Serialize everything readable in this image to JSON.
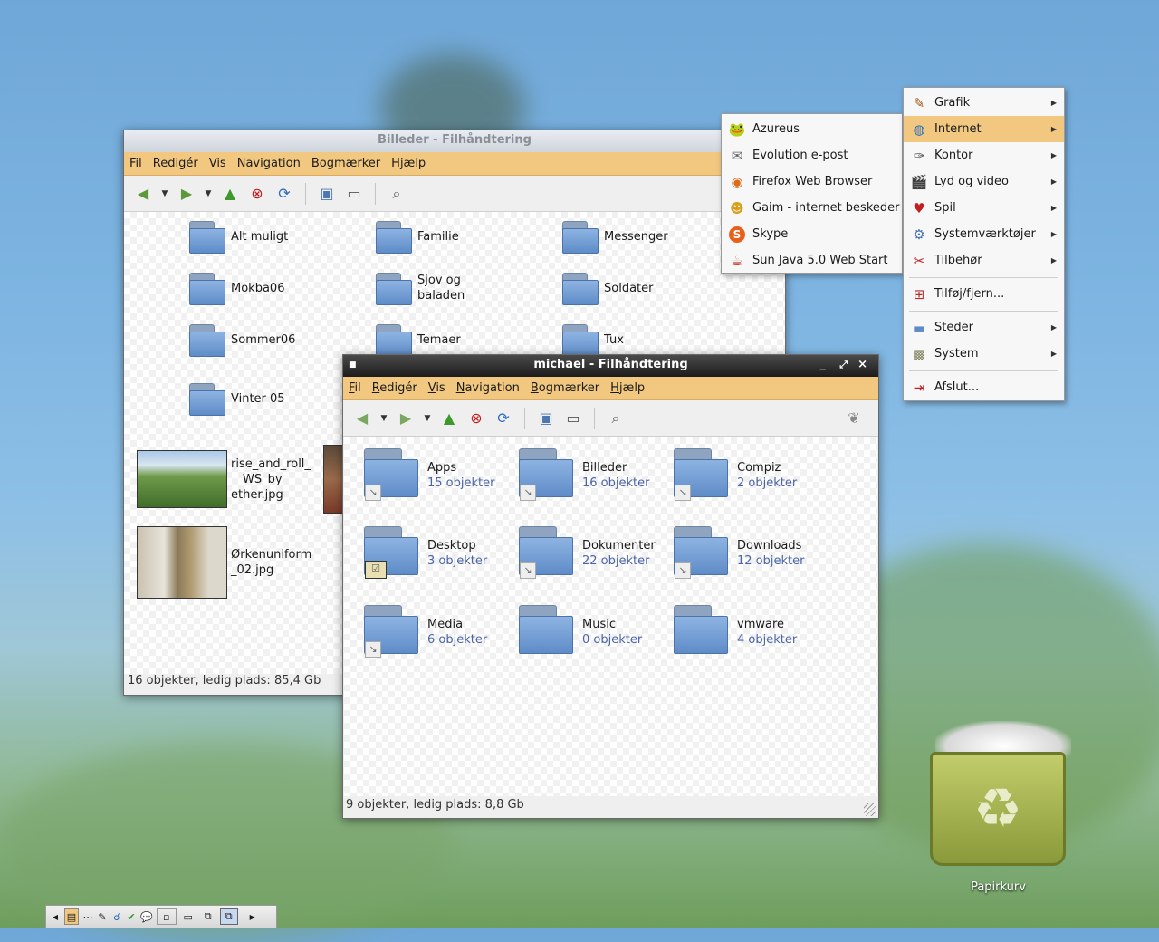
{
  "colors": {
    "menubar": "#f2c880",
    "highlight": "#f2c880",
    "count_text": "#4b63a8",
    "front_titlebar": "#1c1c1c"
  },
  "back_window": {
    "title": "Billeder - Filhåndtering",
    "menu": [
      "Fil",
      "Redigér",
      "Vis",
      "Navigation",
      "Bogmærker",
      "Hjælp"
    ],
    "toolbar_icons": [
      "back-arrow-icon",
      "dropdown-icon",
      "forward-arrow-icon",
      "dropdown-icon",
      "up-arrow-icon",
      "stop-icon",
      "reload-icon",
      "home-folder-icon",
      "computer-icon",
      "search-icon"
    ],
    "items": [
      {
        "name": "Alt muligt"
      },
      {
        "name": "Familie"
      },
      {
        "name": "Messenger"
      },
      {
        "name": "Mokba06"
      },
      {
        "name": "Sjov og\nbaladen"
      },
      {
        "name": "Soldater"
      },
      {
        "name": "Sommer06"
      },
      {
        "name": "Temaer"
      },
      {
        "name": "Tux"
      },
      {
        "name": "Vinter 05"
      },
      {
        "name": "rise_and_roll_\n__WS_by_\nether.jpg"
      },
      {
        "name": "Ørkenuniform\n_02.jpg"
      }
    ],
    "status": "16 objekter, ledig plads: 85,4 Gb"
  },
  "front_window": {
    "title": "michael - Filhåndtering",
    "menu": [
      "Fil",
      "Redigér",
      "Vis",
      "Navigation",
      "Bogmærker",
      "Hjælp"
    ],
    "title_controls": [
      "_",
      "⤢",
      "×"
    ],
    "items": [
      {
        "name": "Apps",
        "count": "15 objekter"
      },
      {
        "name": "Billeder",
        "count": "16 objekter"
      },
      {
        "name": "Compiz",
        "count": "2 objekter"
      },
      {
        "name": "Desktop",
        "count": "3 objekter"
      },
      {
        "name": "Dokumenter",
        "count": "22 objekter"
      },
      {
        "name": "Downloads",
        "count": "12 objekter"
      },
      {
        "name": "Media",
        "count": "6 objekter"
      },
      {
        "name": "Music",
        "count": "0 objekter"
      },
      {
        "name": "vmware",
        "count": "4 objekter"
      }
    ],
    "status": "9 objekter, ledig plads: 8,8 Gb"
  },
  "main_menu": {
    "items": [
      {
        "label": "Grafik",
        "icon": "paintbrush-icon",
        "submenu": true
      },
      {
        "label": "Internet",
        "icon": "globe-icon",
        "submenu": true,
        "active": true
      },
      {
        "label": "Kontor",
        "icon": "office-icon",
        "submenu": true
      },
      {
        "label": "Lyd og video",
        "icon": "clapper-icon",
        "submenu": true
      },
      {
        "label": "Spil",
        "icon": "cards-icon",
        "submenu": true
      },
      {
        "label": "Systemværktøjer",
        "icon": "gear-icon",
        "submenu": true
      },
      {
        "label": "Tilbehør",
        "icon": "tools-icon",
        "submenu": true
      },
      {
        "label": "Tilføj/fjern...",
        "icon": "package-icon",
        "submenu": false
      },
      {
        "label": "Steder",
        "icon": "folder-icon",
        "submenu": true
      },
      {
        "label": "System",
        "icon": "system-icon",
        "submenu": true
      },
      {
        "label": "Afslut...",
        "icon": "logout-icon",
        "submenu": false
      }
    ]
  },
  "internet_submenu": {
    "items": [
      {
        "label": "Azureus",
        "icon": "azureus-icon"
      },
      {
        "label": "Evolution e-post",
        "icon": "evolution-icon"
      },
      {
        "label": "Firefox Web Browser",
        "icon": "firefox-icon"
      },
      {
        "label": "Gaim - internet beskeder",
        "icon": "gaim-icon"
      },
      {
        "label": "Skype",
        "icon": "skype-icon"
      },
      {
        "label": "Sun Java 5.0 Web Start",
        "icon": "java-icon"
      }
    ]
  },
  "desktop": {
    "trash_label": "Papirkurv"
  }
}
